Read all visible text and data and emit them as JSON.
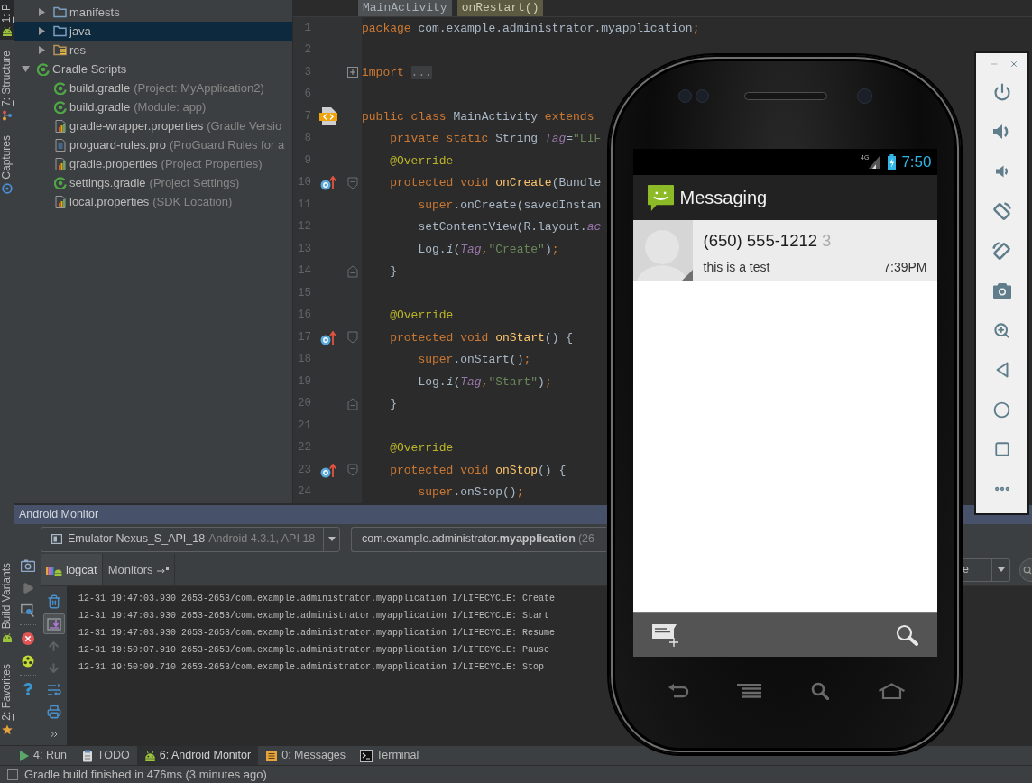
{
  "tool_strip": {
    "top": [
      {
        "kind": "project",
        "label": "1: P",
        "mnemonic": true,
        "selected": true
      },
      {
        "kind": "structure",
        "label": "7: Structure",
        "mnemonic": true,
        "selected": false
      },
      {
        "kind": "captures",
        "label": "Captures",
        "mnemonic": false,
        "selected": false
      }
    ],
    "bottom": [
      {
        "kind": "build-variants",
        "label": "Build Variants",
        "mnemonic": false,
        "selected": false
      },
      {
        "kind": "favorites",
        "label": "2: Favorites",
        "mnemonic": true,
        "selected": false
      }
    ]
  },
  "project_tree": [
    {
      "children": [
        {
          "kind": "folder",
          "label": "manifests",
          "expanded": false,
          "selected": false
        },
        {
          "kind": "folder",
          "label": "java",
          "expanded": false,
          "selected": true
        },
        {
          "kind": "res-folder",
          "label": "res",
          "expanded": false,
          "selected": false
        }
      ]
    },
    {
      "kind": "gradle",
      "label": "Gradle Scripts",
      "expanded": true,
      "selected": false,
      "children": [
        {
          "kind": "gradle",
          "label": "build.gradle",
          "hint": "(Project: MyApplication2)",
          "selected": false
        },
        {
          "kind": "gradle",
          "label": "build.gradle",
          "hint": "(Module: app)",
          "selected": false
        },
        {
          "kind": "properties",
          "label": "gradle-wrapper.properties",
          "hint": "(Gradle Versio",
          "selected": false
        },
        {
          "kind": "text-file",
          "label": "proguard-rules.pro",
          "hint": "(ProGuard Rules for a",
          "selected": false
        },
        {
          "kind": "properties",
          "label": "gradle.properties",
          "hint": "(Project Properties)",
          "selected": false
        },
        {
          "kind": "gradle",
          "label": "settings.gradle",
          "hint": "(Project Settings)",
          "selected": false
        },
        {
          "kind": "properties",
          "label": "local.properties",
          "hint": "(SDK Location)",
          "selected": false
        }
      ]
    }
  ],
  "editor": {
    "breadcrumbs": [
      {
        "kind": "class",
        "label": "MainActivity"
      },
      {
        "kind": "method",
        "label": "onRestart()"
      }
    ],
    "lines": [
      {
        "number": "1",
        "code": [
          {
            "kind": "keyword",
            "text": "package"
          },
          {
            "kind": "plain",
            "text": " com.example.administrator.myapplication"
          },
          {
            "kind": "keyword",
            "text": ";"
          }
        ]
      },
      {
        "number": "2"
      },
      {
        "number": "3",
        "fold": {
          "kind": "folded"
        },
        "code": [
          {
            "kind": "keyword",
            "text": "import "
          },
          {
            "kind": "folded",
            "text": "..."
          }
        ]
      },
      {
        "number": "6"
      },
      {
        "number": "7",
        "marker": {
          "kind": "class"
        },
        "code": [
          {
            "kind": "keyword",
            "text": "public class"
          },
          {
            "kind": "plain",
            "text": " MainActivity "
          },
          {
            "kind": "keyword",
            "text": "extends"
          }
        ]
      },
      {
        "number": "8",
        "code": [
          {
            "kind": "keyword",
            "text": "    private static"
          },
          {
            "kind": "plain",
            "text": " String "
          },
          {
            "kind": "field",
            "text": "Tag"
          },
          {
            "kind": "plain",
            "text": "="
          },
          {
            "kind": "string",
            "text": "\"LIF"
          }
        ]
      },
      {
        "number": "9",
        "code": [
          {
            "kind": "annotation",
            "text": "    @Override"
          }
        ]
      },
      {
        "number": "10",
        "marker": {
          "kind": "override"
        },
        "fold": {
          "kind": "start"
        },
        "code": [
          {
            "kind": "keyword",
            "text": "    protected void "
          },
          {
            "kind": "method",
            "text": "onCreate"
          },
          {
            "kind": "plain",
            "text": "(Bundle"
          }
        ]
      },
      {
        "number": "11",
        "code": [
          {
            "kind": "keyword",
            "text": "        super"
          },
          {
            "kind": "plain",
            "text": ".onCreate(savedInstan"
          }
        ]
      },
      {
        "number": "12",
        "code": [
          {
            "kind": "plain",
            "text": "        setContentView(R.layout."
          },
          {
            "kind": "field",
            "text": "ac"
          }
        ]
      },
      {
        "number": "13",
        "code": [
          {
            "kind": "plain",
            "text": "        Log."
          },
          {
            "kind": "static-call",
            "text": "i"
          },
          {
            "kind": "plain",
            "text": "("
          },
          {
            "kind": "field",
            "text": "Tag"
          },
          {
            "kind": "keyword",
            "text": ","
          },
          {
            "kind": "string",
            "text": "\"Create\""
          },
          {
            "kind": "plain",
            "text": ")"
          },
          {
            "kind": "keyword",
            "text": ";"
          }
        ]
      },
      {
        "number": "14",
        "fold": {
          "kind": "end"
        },
        "code": [
          {
            "kind": "plain",
            "text": "    }"
          }
        ]
      },
      {
        "number": "15"
      },
      {
        "number": "16",
        "code": [
          {
            "kind": "annotation",
            "text": "    @Override"
          }
        ]
      },
      {
        "number": "17",
        "marker": {
          "kind": "override"
        },
        "fold": {
          "kind": "start"
        },
        "code": [
          {
            "kind": "keyword",
            "text": "    protected void "
          },
          {
            "kind": "method",
            "text": "onStart"
          },
          {
            "kind": "plain",
            "text": "() {"
          }
        ]
      },
      {
        "number": "18",
        "code": [
          {
            "kind": "keyword",
            "text": "        super"
          },
          {
            "kind": "plain",
            "text": ".onStart()"
          },
          {
            "kind": "keyword",
            "text": ";"
          }
        ]
      },
      {
        "number": "19",
        "code": [
          {
            "kind": "plain",
            "text": "        Log."
          },
          {
            "kind": "static-call",
            "text": "i"
          },
          {
            "kind": "plain",
            "text": "("
          },
          {
            "kind": "field",
            "text": "Tag"
          },
          {
            "kind": "keyword",
            "text": ","
          },
          {
            "kind": "string",
            "text": "\"Start\""
          },
          {
            "kind": "plain",
            "text": ")"
          },
          {
            "kind": "keyword",
            "text": ";"
          }
        ]
      },
      {
        "number": "20",
        "fold": {
          "kind": "end"
        },
        "code": [
          {
            "kind": "plain",
            "text": "    }"
          }
        ]
      },
      {
        "number": "21"
      },
      {
        "number": "22",
        "code": [
          {
            "kind": "annotation",
            "text": "    @Override"
          }
        ]
      },
      {
        "number": "23",
        "marker": {
          "kind": "override"
        },
        "fold": {
          "kind": "start"
        },
        "code": [
          {
            "kind": "keyword",
            "text": "    protected void "
          },
          {
            "kind": "method",
            "text": "onStop"
          },
          {
            "kind": "plain",
            "text": "() {"
          }
        ]
      },
      {
        "number": "24",
        "code": [
          {
            "kind": "keyword",
            "text": "        super"
          },
          {
            "kind": "plain",
            "text": ".onStop()"
          },
          {
            "kind": "keyword",
            "text": ";"
          }
        ]
      }
    ]
  },
  "android_monitor": {
    "title": "Android Monitor",
    "device": {
      "name": "Emulator Nexus_S_API_18",
      "detail": "Android 4.3.1, API 18"
    },
    "process": {
      "name": "com.example.administrator.**myapplication**",
      "detail": "(26"
    },
    "tabs": [
      {
        "kind": "logcat",
        "label": "logcat",
        "selected": true
      },
      {
        "kind": "monitors",
        "label": "Monitors",
        "selected": false
      }
    ],
    "log_level": "e",
    "logcat_tools": [
      {
        "kind": "clear",
        "on": false
      },
      {
        "kind": "scroll-to-end",
        "on": true
      },
      {
        "kind": "up",
        "on": false
      },
      {
        "kind": "down",
        "on": false
      },
      {
        "kind": "soft-wrap",
        "on": false
      },
      {
        "kind": "print",
        "on": false
      },
      {
        "kind": "more",
        "on": false
      }
    ],
    "log_lines": [
      "12-31 19:47:03.930 2653-2653/com.example.administrator.myapplication I/LIFECYCLE: Create",
      "12-31 19:47:03.930 2653-2653/com.example.administrator.myapplication I/LIFECYCLE: Start",
      "12-31 19:47:03.930 2653-2653/com.example.administrator.myapplication I/LIFECYCLE: Resume",
      "12-31 19:50:07.910 2653-2653/com.example.administrator.myapplication I/LIFECYCLE: Pause",
      "12-31 19:50:09.710 2653-2653/com.example.administrator.myapplication I/LIFECYCLE: Stop"
    ]
  },
  "tool_window_bar": [
    {
      "kind": "run",
      "label": "4: Run",
      "mnemonic": true,
      "selected": false
    },
    {
      "kind": "todo",
      "label": "TODO",
      "mnemonic": false,
      "selected": false
    },
    {
      "kind": "android-monitor",
      "label": "6: Android Monitor",
      "mnemonic": true,
      "selected": true
    },
    {
      "kind": "messages",
      "label": "0: Messages",
      "mnemonic": true,
      "selected": false
    },
    {
      "kind": "terminal",
      "label": "Terminal",
      "mnemonic": false,
      "selected": false
    }
  ],
  "status_bar": {
    "message": "Gradle build finished in 476ms (3 minutes ago)"
  },
  "emulator": {
    "status_bar": {
      "network": "4G",
      "time": "7:50"
    },
    "app_bar": {
      "title": "Messaging"
    },
    "conversations": [
      {
        "sender": "(650) 555-1212",
        "count": "3",
        "snippet": "this is a test",
        "time": "7:39PM"
      }
    ]
  }
}
